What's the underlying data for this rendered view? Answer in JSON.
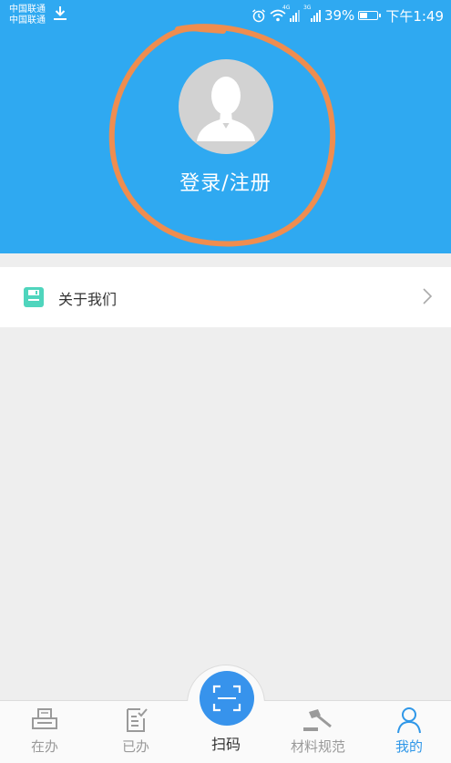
{
  "status_bar": {
    "carrier_1": "中国联通",
    "carrier_2": "中国联通",
    "net_1": "4G",
    "net_2": "3G",
    "battery": "39%",
    "time": "下午1:49",
    "icons": [
      "download-icon",
      "alarm-icon",
      "wifi-icon",
      "signal-icon",
      "battery-icon"
    ]
  },
  "profile": {
    "login_label": "登录/注册",
    "avatar_icon": "default-avatar-icon"
  },
  "menu": {
    "about_label": "关于我们",
    "about_icon": "save-icon",
    "chevron_icon": "chevron-right-icon"
  },
  "tabs": [
    {
      "label": "在办",
      "icon": "printer-icon",
      "active": false
    },
    {
      "label": "已办",
      "icon": "checklist-icon",
      "active": false
    },
    {
      "label": "扫码",
      "icon": "scan-icon",
      "active": false
    },
    {
      "label": "材料规范",
      "icon": "gavel-icon",
      "active": false
    },
    {
      "label": "我的",
      "icon": "person-icon",
      "active": true
    }
  ],
  "colors": {
    "header_bg": "#2fa9f1",
    "annotation": "#ef8d4f",
    "active_tab": "#2f97e8",
    "scan_button": "#3793ec",
    "about_icon": "#4fd5bd"
  }
}
